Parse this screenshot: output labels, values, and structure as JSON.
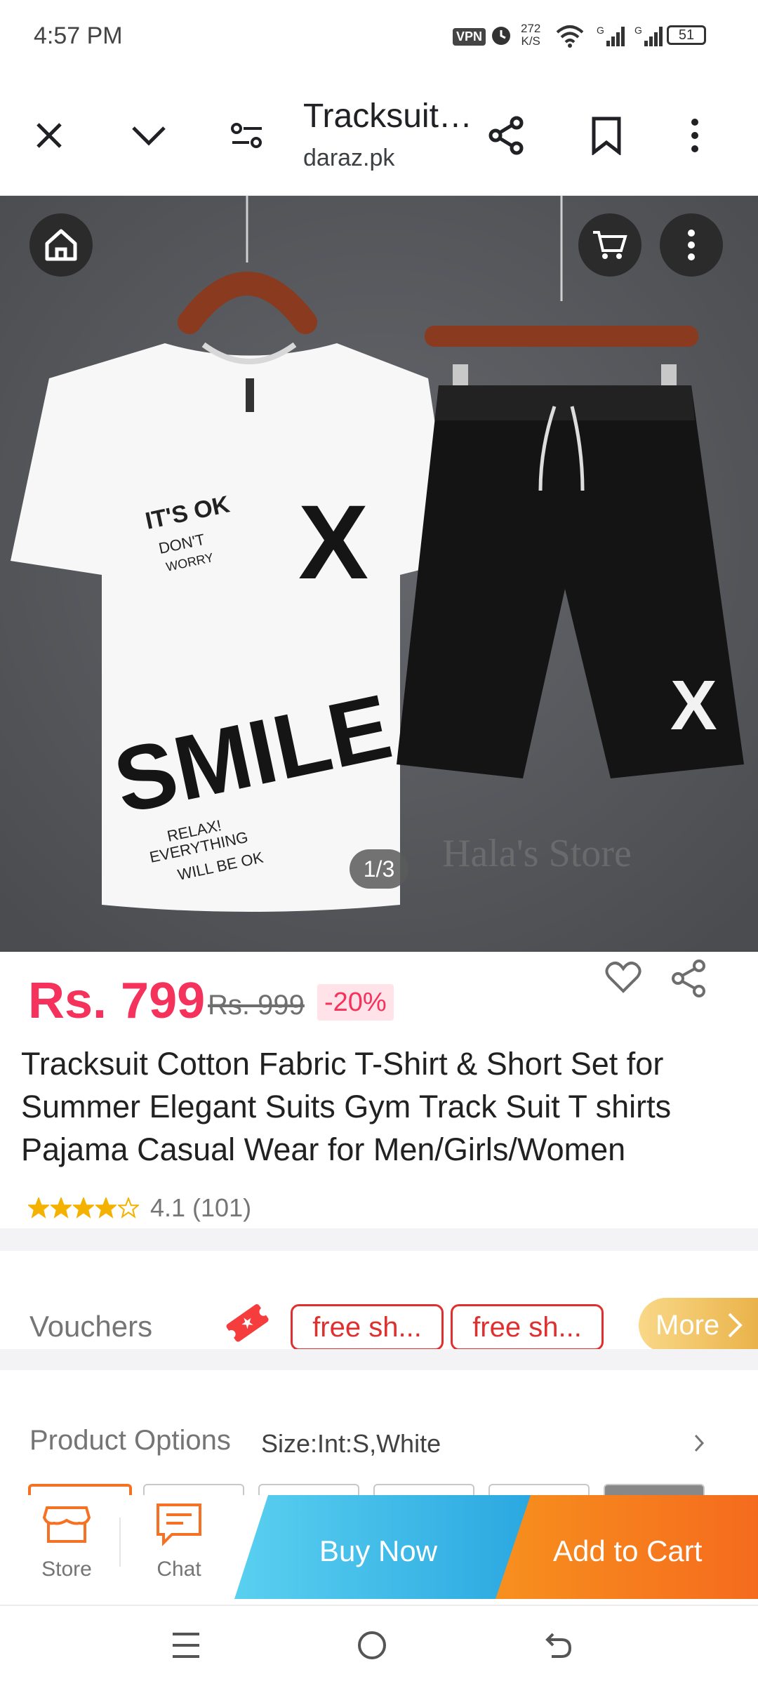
{
  "status_bar": {
    "time": "4:57 PM",
    "vpn": "VPN",
    "speed_value": "272",
    "speed_unit": "K/S",
    "battery": "51"
  },
  "browser_bar": {
    "title": "Tracksuit…",
    "url": "daraz.pk"
  },
  "gallery": {
    "counter": "1/3",
    "shirt_text_top": "IT'S OK",
    "shirt_text_mid": "DON'T",
    "shirt_text_low": "WORRY",
    "shirt_big_text": "SMILE",
    "shirt_small_1": "RELAX!",
    "shirt_small_2": "EVERYTHING",
    "shirt_small_3": "WILL BE OK",
    "shirt_mark": "X",
    "watermark": "Hala's Store"
  },
  "price": {
    "current": "Rs. 799",
    "original": "Rs. 999",
    "discount": "-20%"
  },
  "product": {
    "title": "Tracksuit Cotton Fabric T-Shirt & Short Set for Summer Elegant Suits Gym Track Suit T shirts Pajama Casual Wear for Men/Girls/Women",
    "rating_value": "4.1",
    "rating_count": "(101)",
    "rating_stars": 4.1
  },
  "vouchers": {
    "label": "Vouchers",
    "chips": [
      "free sh...",
      "free sh..."
    ],
    "more": "More"
  },
  "options": {
    "label": "Product Options",
    "value": "Size:Int:S,White"
  },
  "action_bar": {
    "store": "Store",
    "chat": "Chat",
    "buy_now": "Buy Now",
    "add_to_cart": "Add to Cart"
  },
  "colors": {
    "price": "#f5325c",
    "buy_now": "#33b8e8",
    "add_to_cart": "#f57224",
    "voucher": "#e02f2f"
  }
}
